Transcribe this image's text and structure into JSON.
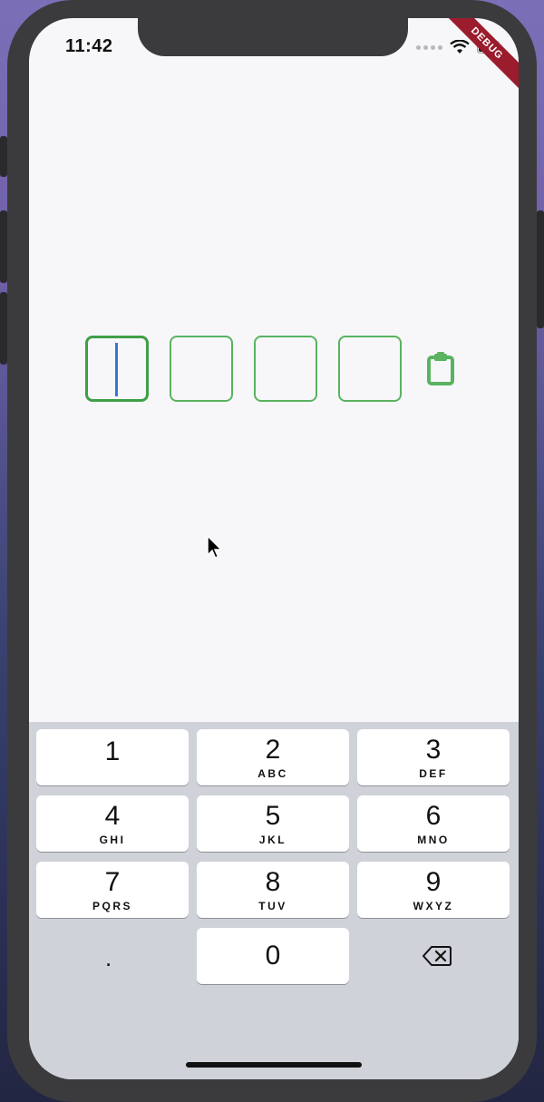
{
  "status_bar": {
    "time": "11:42",
    "debug_label": "DEBUG"
  },
  "otp": {
    "boxes": [
      "",
      "",
      "",
      ""
    ],
    "active_index": 0,
    "border_color": "#59b35f",
    "caret_color": "#3b74d8",
    "paste_icon": "clipboard-icon"
  },
  "keyboard": {
    "keys": [
      {
        "num": "1",
        "letters": ""
      },
      {
        "num": "2",
        "letters": "ABC"
      },
      {
        "num": "3",
        "letters": "DEF"
      },
      {
        "num": "4",
        "letters": "GHI"
      },
      {
        "num": "5",
        "letters": "JKL"
      },
      {
        "num": "6",
        "letters": "MNO"
      },
      {
        "num": "7",
        "letters": "PQRS"
      },
      {
        "num": "8",
        "letters": "TUV"
      },
      {
        "num": "9",
        "letters": "WXYZ"
      }
    ],
    "zero": "0",
    "dot": ".",
    "backspace_icon": "backspace-icon"
  }
}
